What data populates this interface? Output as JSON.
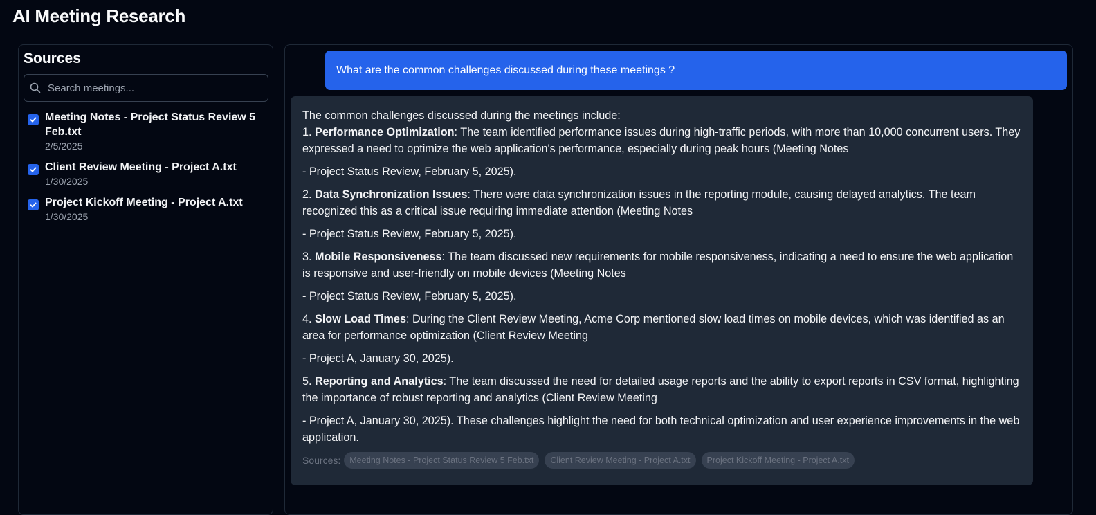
{
  "app": {
    "title": "AI Meeting Research"
  },
  "sidebar": {
    "title": "Sources",
    "search_placeholder": "Search meetings...",
    "items": [
      {
        "name": "Meeting Notes - Project Status Review 5 Feb.txt",
        "date": "2/5/2025",
        "checked": true
      },
      {
        "name": "Client Review Meeting - Project A.txt",
        "date": "1/30/2025",
        "checked": true
      },
      {
        "name": "Project Kickoff Meeting - Project A.txt",
        "date": "1/30/2025",
        "checked": true
      }
    ]
  },
  "chat": {
    "user_message": "What are the common challenges discussed during these meetings ?",
    "assistant": {
      "intro": "The common challenges discussed during the meetings include:",
      "points": [
        {
          "num": "1.",
          "title": "Performance Optimization",
          "text": ": The team identified performance issues during high-traffic periods, with more than 10,000 concurrent users. They expressed a need to optimize the web application's performance, especially during peak hours (Meeting Notes",
          "cite": "- Project Status Review, February 5, 2025)."
        },
        {
          "num": "2.",
          "title": "Data Synchronization Issues",
          "text": ": There were data synchronization issues in the reporting module, causing delayed analytics. The team recognized this as a critical issue requiring immediate attention (Meeting Notes",
          "cite": "- Project Status Review, February 5, 2025)."
        },
        {
          "num": "3.",
          "title": "Mobile Responsiveness",
          "text": ": The team discussed new requirements for mobile responsiveness, indicating a need to ensure the web application is responsive and user-friendly on mobile devices (Meeting Notes",
          "cite": "- Project Status Review, February 5, 2025)."
        },
        {
          "num": "4.",
          "title": "Slow Load Times",
          "text": ": During the Client Review Meeting, Acme Corp mentioned slow load times on mobile devices, which was identified as an area for performance optimization (Client Review Meeting",
          "cite": "- Project A, January 30, 2025)."
        },
        {
          "num": "5.",
          "title": "Reporting and Analytics",
          "text": ": The team discussed the need for detailed usage reports and the ability to export reports in CSV format, highlighting the importance of robust reporting and analytics (Client Review Meeting",
          "cite": "- Project A, January 30, 2025). These challenges highlight the need for both technical optimization and user experience improvements in the web application."
        }
      ],
      "sources_label": "Sources:",
      "sources": [
        "Meeting Notes - Project Status Review 5 Feb.txt",
        "Client Review Meeting - Project A.txt",
        "Project Kickoff Meeting - Project A.txt"
      ]
    }
  },
  "colors": {
    "background": "#030712",
    "accent": "#2563eb",
    "assistant_bubble": "#1f2937"
  }
}
